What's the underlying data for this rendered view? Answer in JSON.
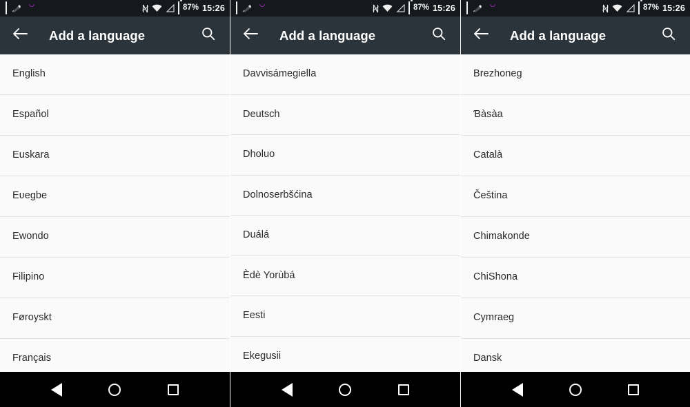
{
  "status_bar": {
    "icons_left": [
      "screenshot-icon",
      "clip-icon",
      "photos-icon",
      "image-icon"
    ],
    "nfc_label": "N",
    "battery_percent": "87%",
    "time": "15:26",
    "icons_right": [
      "nfc-icon",
      "wifi-icon",
      "signal-icon",
      "battery-icon"
    ]
  },
  "toolbar": {
    "back_icon": "arrow-back-icon",
    "title": "Add a language",
    "search_icon": "search-icon"
  },
  "nav_bar": {
    "back_label": "back-icon",
    "home_label": "home-icon",
    "recents_label": "recents-icon"
  },
  "colors": {
    "status_bar_bg": "#15181C",
    "toolbar_bg": "#2B343B",
    "list_bg": "#FAFAFA",
    "divider": "#E3E3E3",
    "text_primary": "#2A2A2A",
    "nav_bar_bg": "#000000",
    "toolbar_text": "#FFFFFF"
  },
  "panels": [
    {
      "id": "panel-1",
      "languages": [
        "English",
        "Español",
        "Euskara",
        "Eʋegbe",
        "Ewondo",
        "Filipino",
        "Føroyskt",
        "Français"
      ]
    },
    {
      "id": "panel-2",
      "languages": [
        "Davvisámegiella",
        "Deutsch",
        "Dholuo",
        "Dolnoserbšćina",
        "Duálá",
        "Èdè Yorùbá",
        "Eesti",
        "Ekegusii"
      ]
    },
    {
      "id": "panel-3",
      "languages": [
        "Brezhoneg",
        "Ɓàsàa",
        "Català",
        "Čeština",
        "Chimakonde",
        "ChiShona",
        "Cymraeg",
        "Dansk"
      ]
    }
  ]
}
